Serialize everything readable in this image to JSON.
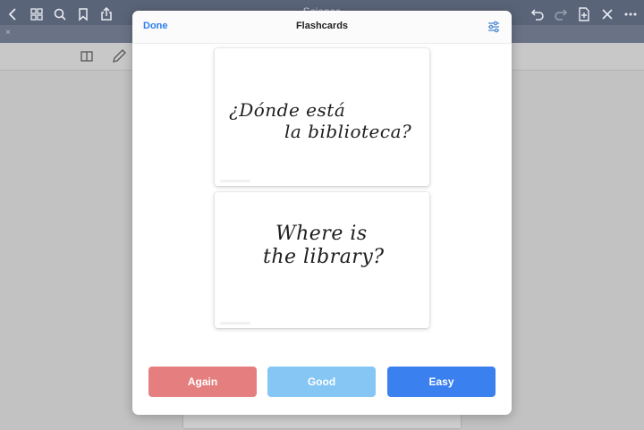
{
  "app": {
    "title": "Science"
  },
  "modal": {
    "title": "Flashcards",
    "done_label": "Done",
    "front_card": {
      "line1": "¿Dónde está",
      "line2": "la biblioteca?"
    },
    "back_card": {
      "line1": "Where is",
      "line2": "the library?"
    },
    "buttons": [
      {
        "label": "Again",
        "color": "#e57f7f"
      },
      {
        "label": "Good",
        "color": "#85c6f5"
      },
      {
        "label": "Easy",
        "color": "#3a80ef"
      }
    ]
  },
  "colors": {
    "accent": "#2f80ed",
    "app_bar": "#5a6478"
  },
  "icons": [
    "back-chevron-icon",
    "grid-icon",
    "search-icon",
    "bookmark-icon",
    "share-icon",
    "undo-icon",
    "redo-icon",
    "add-page-icon",
    "close-icon",
    "more-icon",
    "book-icon",
    "pencil-icon",
    "sliders-icon"
  ]
}
